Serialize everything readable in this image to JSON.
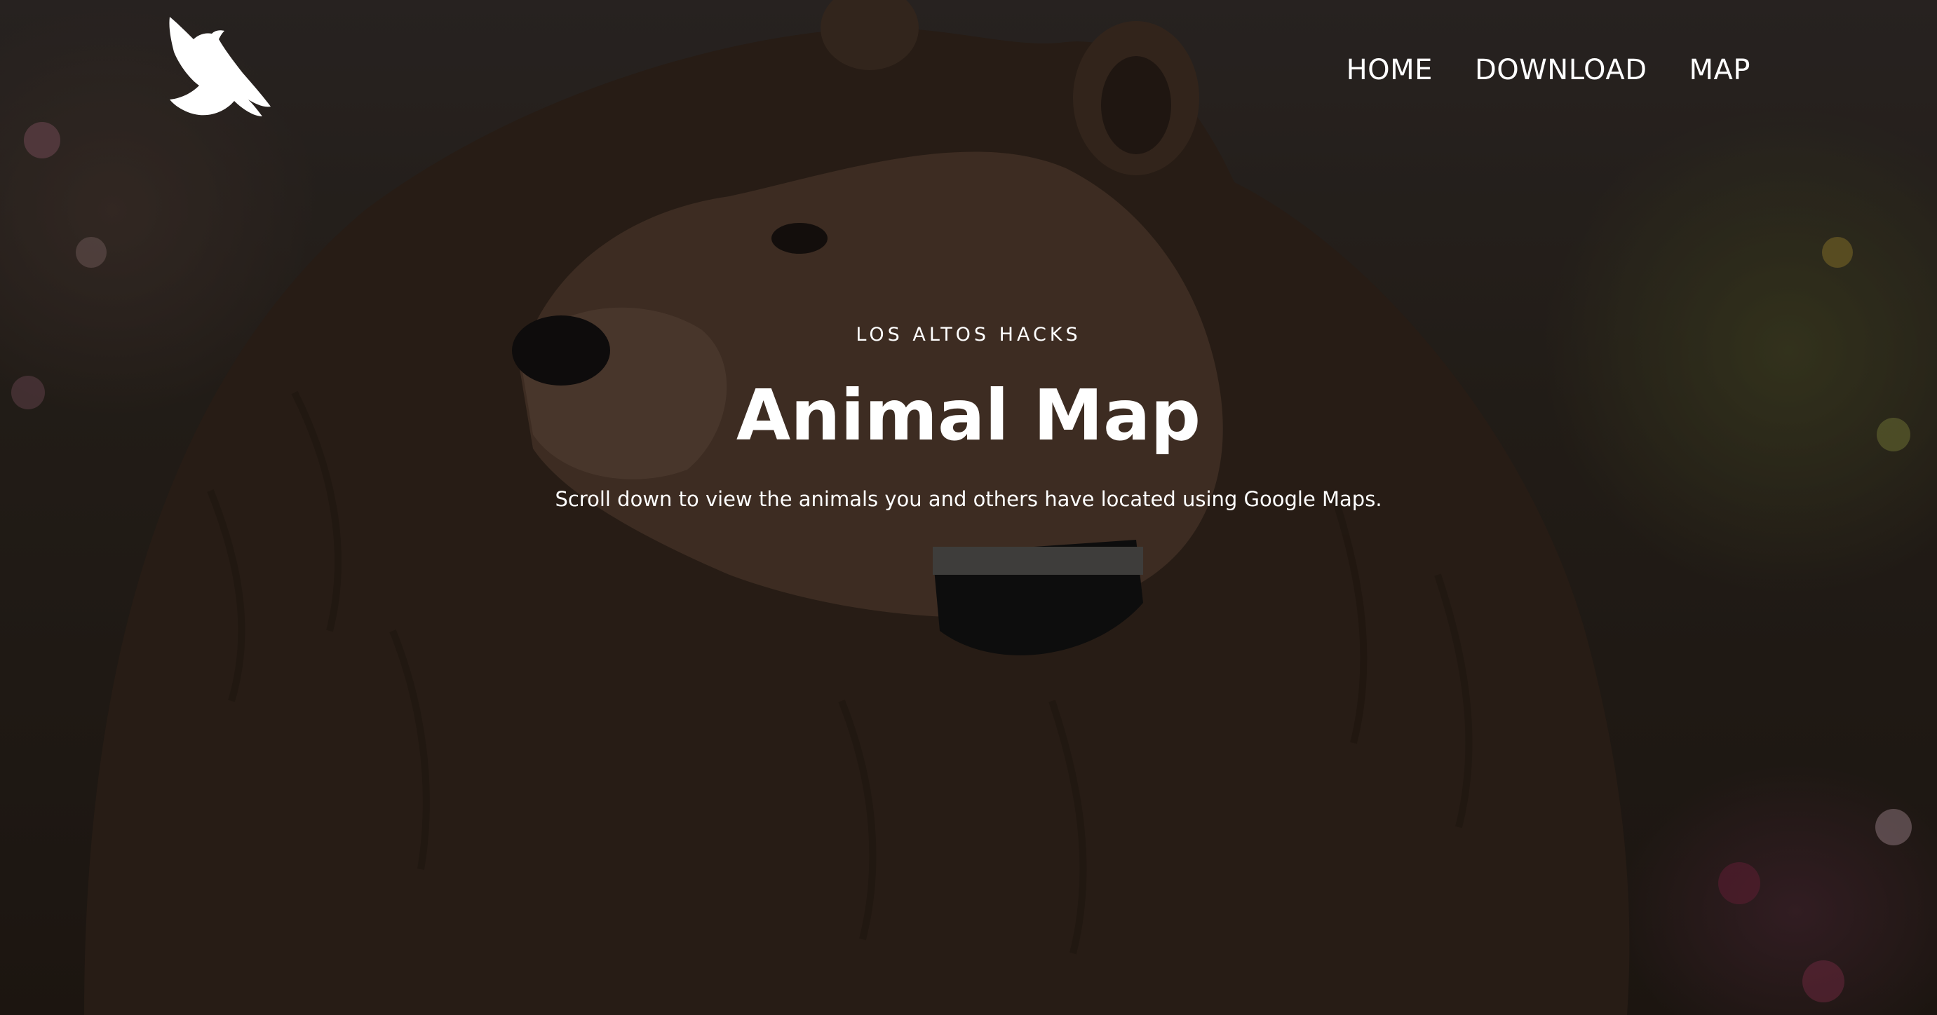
{
  "nav": {
    "items": [
      "HOME",
      "DOWNLOAD",
      "MAP"
    ]
  },
  "hero": {
    "kicker": "LOS ALTOS HACKS",
    "title": "Animal Map",
    "subtitle": "Scroll down to view the animals you and others have located using Google Maps."
  },
  "icons": {
    "logo": "bird-icon"
  }
}
